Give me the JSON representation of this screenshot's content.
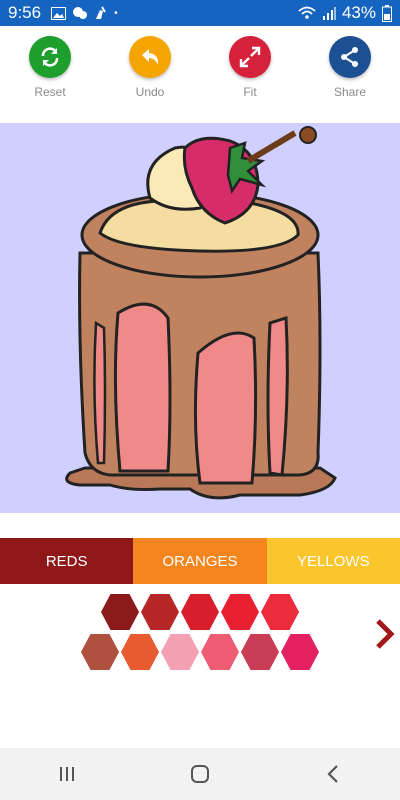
{
  "status": {
    "time": "9:56",
    "battery": "43%"
  },
  "toolbar": {
    "reset": {
      "label": "Reset",
      "color": "#1e9e2c",
      "icon": "refresh-icon"
    },
    "undo": {
      "label": "Undo",
      "color": "#f4a500",
      "icon": "undo-icon"
    },
    "fit": {
      "label": "Fit",
      "color": "#d6213a",
      "icon": "expand-icon"
    },
    "share": {
      "label": "Share",
      "color": "#1d4f93",
      "icon": "share-icon"
    }
  },
  "tabs": [
    {
      "label": "REDS",
      "color": "#8e1818"
    },
    {
      "label": "ORANGES",
      "color": "#f5861f"
    },
    {
      "label": "YELLOWS",
      "color": "#fbc62d"
    }
  ],
  "palette": {
    "row1": [
      "#8b1a1a",
      "#b52626",
      "#d61f2a",
      "#e8202f",
      "#ec2b3c"
    ],
    "row2": [
      "#b0503e",
      "#e85a30",
      "#f4a0b2",
      "#ee5d74",
      "#c93d57",
      "#e32160"
    ]
  },
  "nav": {
    "recents": "recents-icon",
    "home": "home-icon",
    "back": "back-icon"
  }
}
